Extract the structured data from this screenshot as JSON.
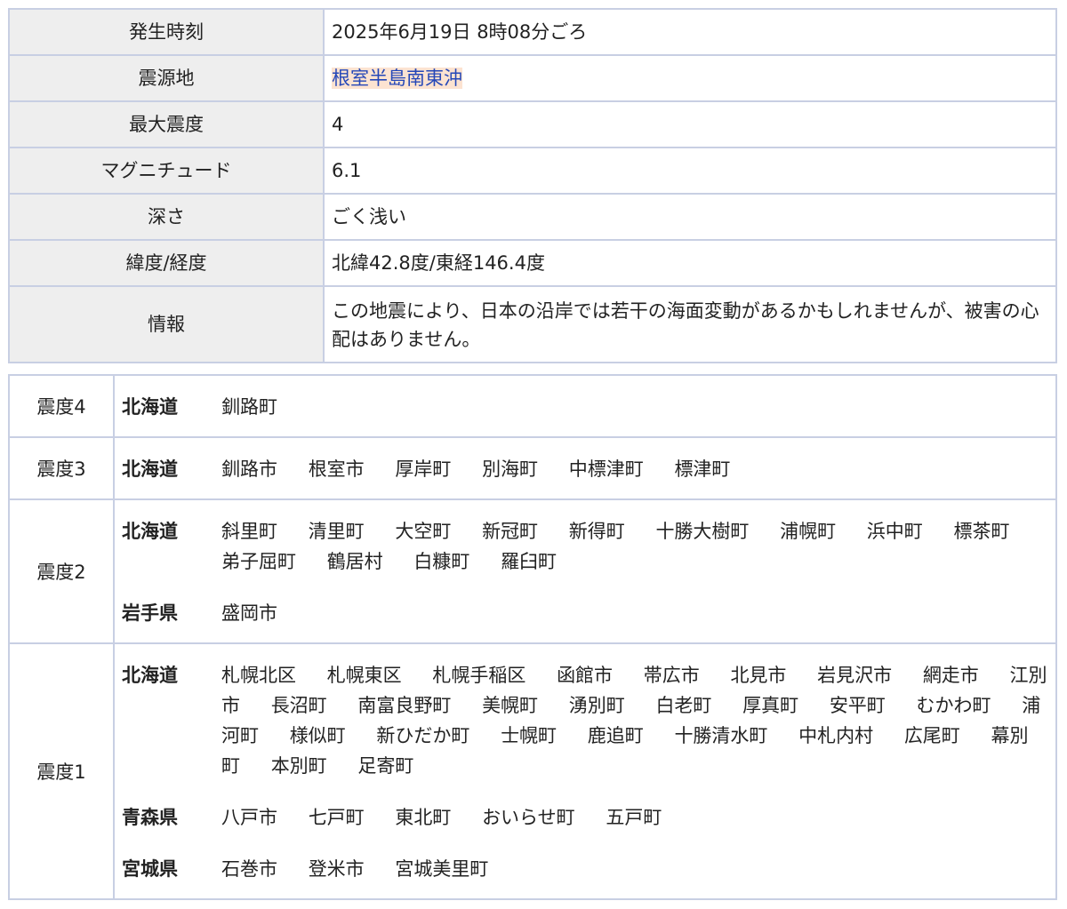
{
  "info": {
    "rows": [
      {
        "label": "発生時刻",
        "value": "2025年6月19日 8時08分ごろ"
      },
      {
        "label": "震源地",
        "value": "根室半島南東沖"
      },
      {
        "label": "最大震度",
        "value": "4"
      },
      {
        "label": "マグニチュード",
        "value": "6.1"
      },
      {
        "label": "深さ",
        "value": "ごく浅い"
      },
      {
        "label": "緯度/経度",
        "value": "北緯42.8度/東経146.4度"
      },
      {
        "label": "情報",
        "value": "この地震により、日本の沿岸では若干の海面変動があるかもしれませんが、被害の心配はありません。"
      }
    ]
  },
  "intensity": [
    {
      "level": "震度4",
      "groups": [
        {
          "pref": "北海道",
          "cities": [
            "釧路町"
          ]
        }
      ]
    },
    {
      "level": "震度3",
      "groups": [
        {
          "pref": "北海道",
          "cities": [
            "釧路市",
            "根室市",
            "厚岸町",
            "別海町",
            "中標津町",
            "標津町"
          ]
        }
      ]
    },
    {
      "level": "震度2",
      "groups": [
        {
          "pref": "北海道",
          "cities": [
            "斜里町",
            "清里町",
            "大空町",
            "新冠町",
            "新得町",
            "十勝大樹町",
            "浦幌町",
            "浜中町",
            "標茶町",
            "弟子屈町",
            "鶴居村",
            "白糠町",
            "羅臼町"
          ]
        },
        {
          "pref": "岩手県",
          "cities": [
            "盛岡市"
          ]
        }
      ]
    },
    {
      "level": "震度1",
      "groups": [
        {
          "pref": "北海道",
          "cities": [
            "札幌北区",
            "札幌東区",
            "札幌手稲区",
            "函館市",
            "帯広市",
            "北見市",
            "岩見沢市",
            "網走市",
            "江別市",
            "長沼町",
            "南富良野町",
            "美幌町",
            "湧別町",
            "白老町",
            "厚真町",
            "安平町",
            "むかわ町",
            "浦河町",
            "様似町",
            "新ひだか町",
            "士幌町",
            "鹿追町",
            "十勝清水町",
            "中札内村",
            "広尾町",
            "幕別町",
            "本別町",
            "足寄町"
          ]
        },
        {
          "pref": "青森県",
          "cities": [
            "八戸市",
            "七戸町",
            "東北町",
            "おいらせ町",
            "五戸町"
          ]
        },
        {
          "pref": "宮城県",
          "cities": [
            "石巻市",
            "登米市",
            "宮城美里町"
          ]
        }
      ]
    }
  ]
}
